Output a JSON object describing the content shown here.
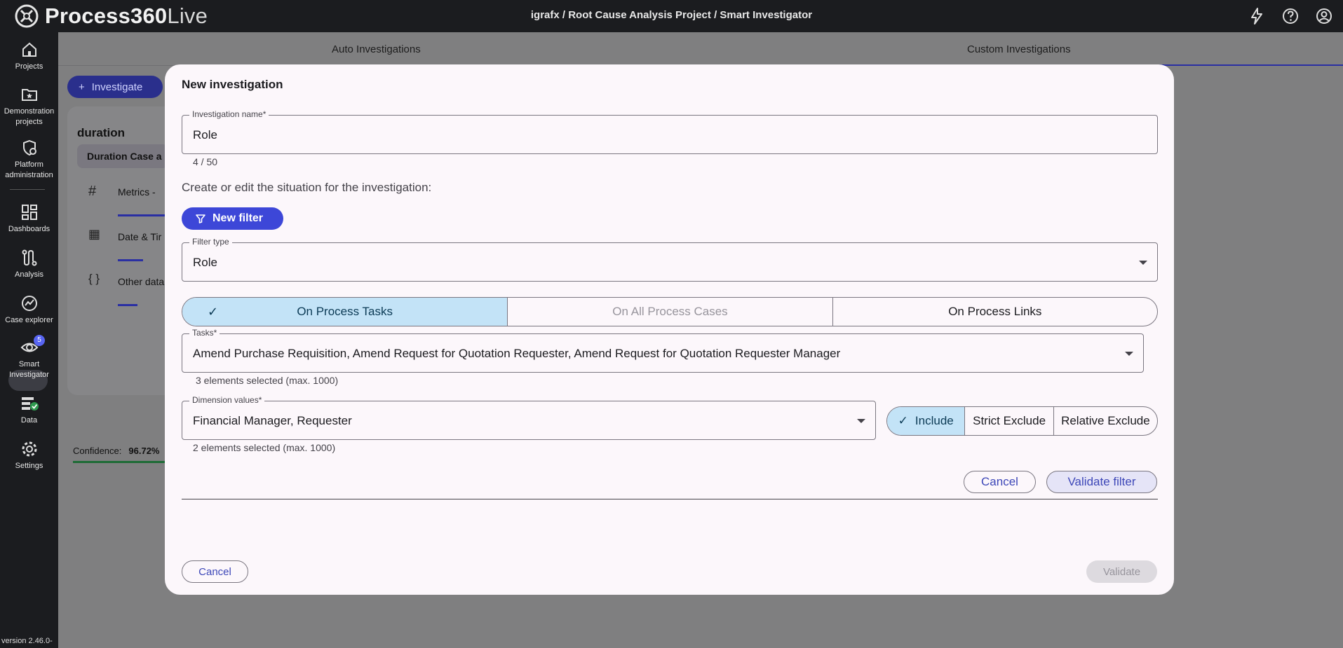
{
  "topbar": {
    "brand_main": "Process360",
    "brand_live": "Live",
    "breadcrumb": "igrafx / Root Cause Analysis Project / Smart Investigator",
    "icons": [
      "lightning-icon",
      "help-icon",
      "account-icon"
    ]
  },
  "nav": {
    "items": [
      {
        "label": "Projects",
        "icon": "home-icon"
      },
      {
        "label": "Demonstration projects",
        "icon": "folder-star-icon"
      },
      {
        "label": "Platform administration",
        "icon": "admin-gear-icon"
      },
      {
        "label": "Dashboards",
        "icon": "dashboard-icon"
      },
      {
        "label": "Analysis",
        "icon": "analysis-icon"
      },
      {
        "label": "Case explorer",
        "icon": "case-explorer-icon"
      },
      {
        "label": "Smart Investigator",
        "icon": "eye-icon"
      },
      {
        "label": "Data",
        "icon": "data-icon"
      },
      {
        "label": "Settings",
        "icon": "settings-icon"
      }
    ],
    "smart_badge": "5",
    "version": "version 2.46.0-"
  },
  "background": {
    "tabs": [
      "Auto Investigations",
      "Custom Investigations"
    ],
    "investigate_label": "Investigate",
    "card_title": "duration",
    "card_chip": "Duration Case a",
    "rows": [
      "Metrics  -",
      "Date & Tir",
      "Other data"
    ],
    "confidence_label": "Confidence:",
    "confidence_value": "96.72%"
  },
  "modal": {
    "title": "New investigation",
    "name_field": {
      "label": "Investigation name*",
      "value": "Role",
      "counter": "4 / 50"
    },
    "prompt": "Create or edit the situation for the investigation:",
    "new_filter_label": "New filter",
    "filter_type": {
      "label": "Filter type",
      "value": "Role"
    },
    "scope_options": [
      "On Process Tasks",
      "On All Process Cases",
      "On Process Links"
    ],
    "scope_selected": "On Process Tasks",
    "tasks": {
      "label": "Tasks*",
      "value": "Amend Purchase Requisition, Amend Request for Quotation Requester, Amend Request for Quotation Requester Manager",
      "helper": "3 elements selected (max. 1000)"
    },
    "dimension": {
      "label": "Dimension values*",
      "value": "Financial Manager, Requester",
      "helper": "2 elements selected (max. 1000)"
    },
    "mode_options": [
      "Include",
      "Strict Exclude",
      "Relative Exclude"
    ],
    "mode_selected": "Include",
    "filter_cancel": "Cancel",
    "validate_filter": "Validate filter",
    "cancel": "Cancel",
    "validate": "Validate"
  }
}
